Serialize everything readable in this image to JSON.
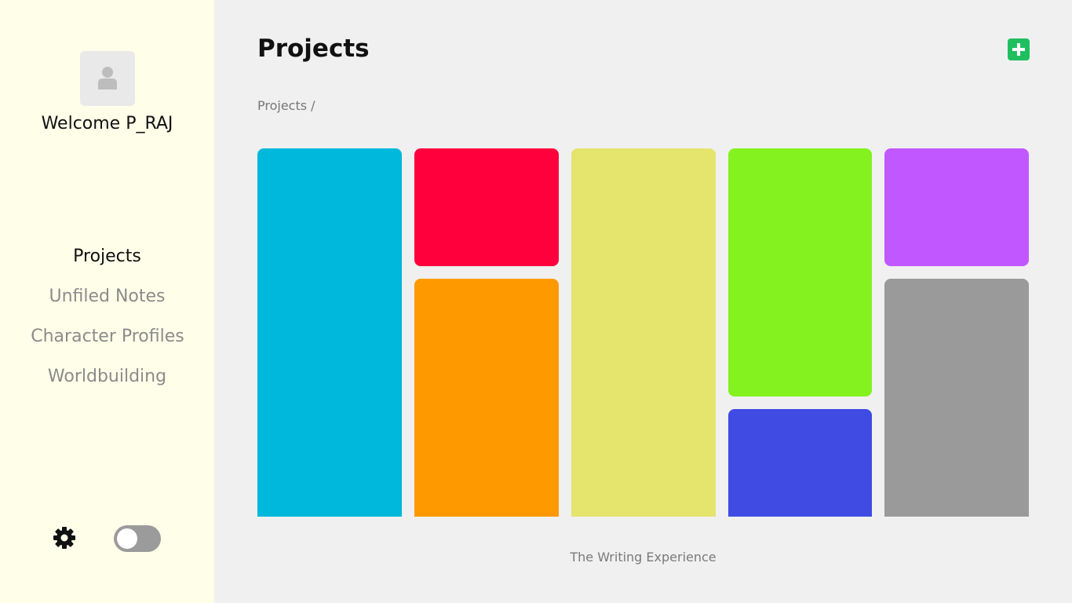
{
  "sidebar": {
    "welcome": "Welcome P_RAJ",
    "items": [
      {
        "label": "Projects"
      },
      {
        "label": "Unfiled Notes"
      },
      {
        "label": "Character Profiles"
      },
      {
        "label": "Worldbuilding"
      }
    ],
    "toggle_state": "off"
  },
  "header": {
    "title": "Projects",
    "add_button_icon": "plus-square-icon"
  },
  "breadcrumb": "Projects /",
  "project_cards": [
    {
      "color": "#00b8db"
    },
    {
      "color": "#ff003c"
    },
    {
      "color": "#ff9900"
    },
    {
      "color": "#e5e46d"
    },
    {
      "color": "#84f21f"
    },
    {
      "color": "#404be3"
    },
    {
      "color": "#c158ff"
    },
    {
      "color": "#9a9a9a"
    }
  ],
  "footer": "The Writing Experience",
  "colors": {
    "sidebar_bg": "#fefee9",
    "main_bg": "#f0f0f0",
    "accent": "#1fbf5f"
  }
}
